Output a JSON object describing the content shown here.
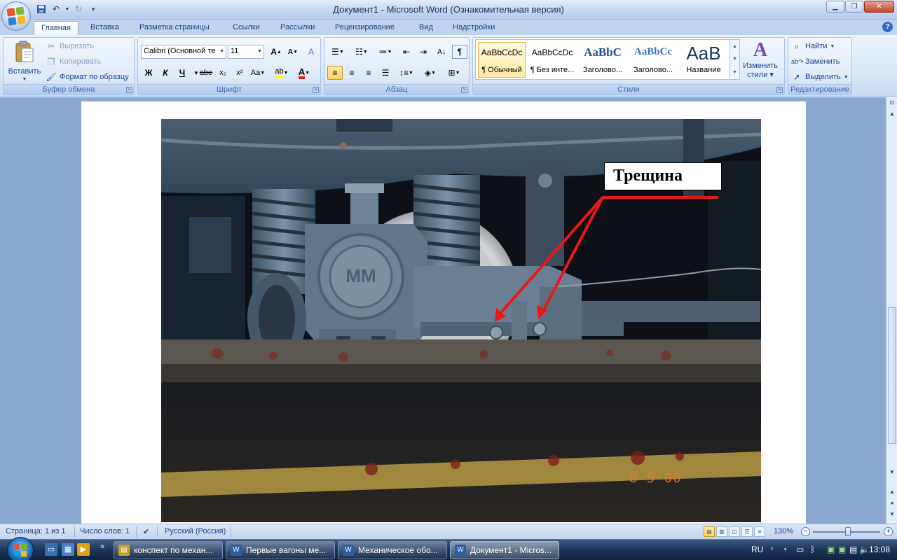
{
  "window": {
    "title": "Документ1 - Microsoft Word (Ознакомительная версия)"
  },
  "quick_access": {
    "save_icon": "save-icon",
    "undo_icon": "undo-icon",
    "redo_icon": "redo-icon",
    "customize_icon": "chevron-down-icon"
  },
  "tabs": [
    {
      "label": "Главная",
      "active": true
    },
    {
      "label": "Вставка"
    },
    {
      "label": "Разметка страницы"
    },
    {
      "label": "Ссылки"
    },
    {
      "label": "Рассылки"
    },
    {
      "label": "Рецензирование"
    },
    {
      "label": "Вид"
    },
    {
      "label": "Надстройки"
    }
  ],
  "clipboard": {
    "paste_label": "Вставить",
    "cut_label": "Вырезать",
    "copy_label": "Копировать",
    "format_painter_label": "Формат по образцу",
    "group_label": "Буфер обмена"
  },
  "font": {
    "font_name": "Calibri (Основной те",
    "font_size": "11",
    "group_label": "Шрифт",
    "bold": "Ж",
    "italic": "К",
    "underline": "Ч",
    "strike": "abe",
    "subscript": "x₂",
    "superscript": "x²",
    "change_case": "Aa",
    "grow": "A",
    "shrink": "A",
    "clear": "A"
  },
  "paragraph": {
    "group_label": "Абзац"
  },
  "styles": {
    "group_label": "Стили",
    "items": [
      {
        "sample": "AaBbCcDc",
        "name": "¶ Обычный",
        "active": true
      },
      {
        "sample": "AaBbCcDc",
        "name": "¶ Без инте..."
      },
      {
        "sample": "AaBbC",
        "name": "Заголово..."
      },
      {
        "sample": "AaBbCc",
        "name": "Заголово..."
      },
      {
        "sample": "AaB",
        "name": "Название"
      }
    ],
    "change_styles_label_1": "Изменить",
    "change_styles_label_2": "стили"
  },
  "editing": {
    "group_label": "Редактирование",
    "find_label": "Найти",
    "replace_label": "Заменить",
    "select_label": "Выделить"
  },
  "document": {
    "annotation_label": "Трещина",
    "photo_timestamp": "8  5'00",
    "colors": {
      "arrow": "#e81818",
      "bogie_steel": "#5b7187",
      "date_stamp": "#e97a2e"
    }
  },
  "statusbar": {
    "page": "Страница: 1 из 1",
    "words": "Число слов: 1",
    "language": "Русский (Россия)",
    "zoom": "130%"
  },
  "taskbar": {
    "items": [
      {
        "label": "конспект по механ..."
      },
      {
        "label": "Первые вагоны ме..."
      },
      {
        "label": "Механическое обо..."
      },
      {
        "label": "Документ1 - Micros...",
        "active": true
      }
    ],
    "language": "RU",
    "time": "13:08"
  }
}
